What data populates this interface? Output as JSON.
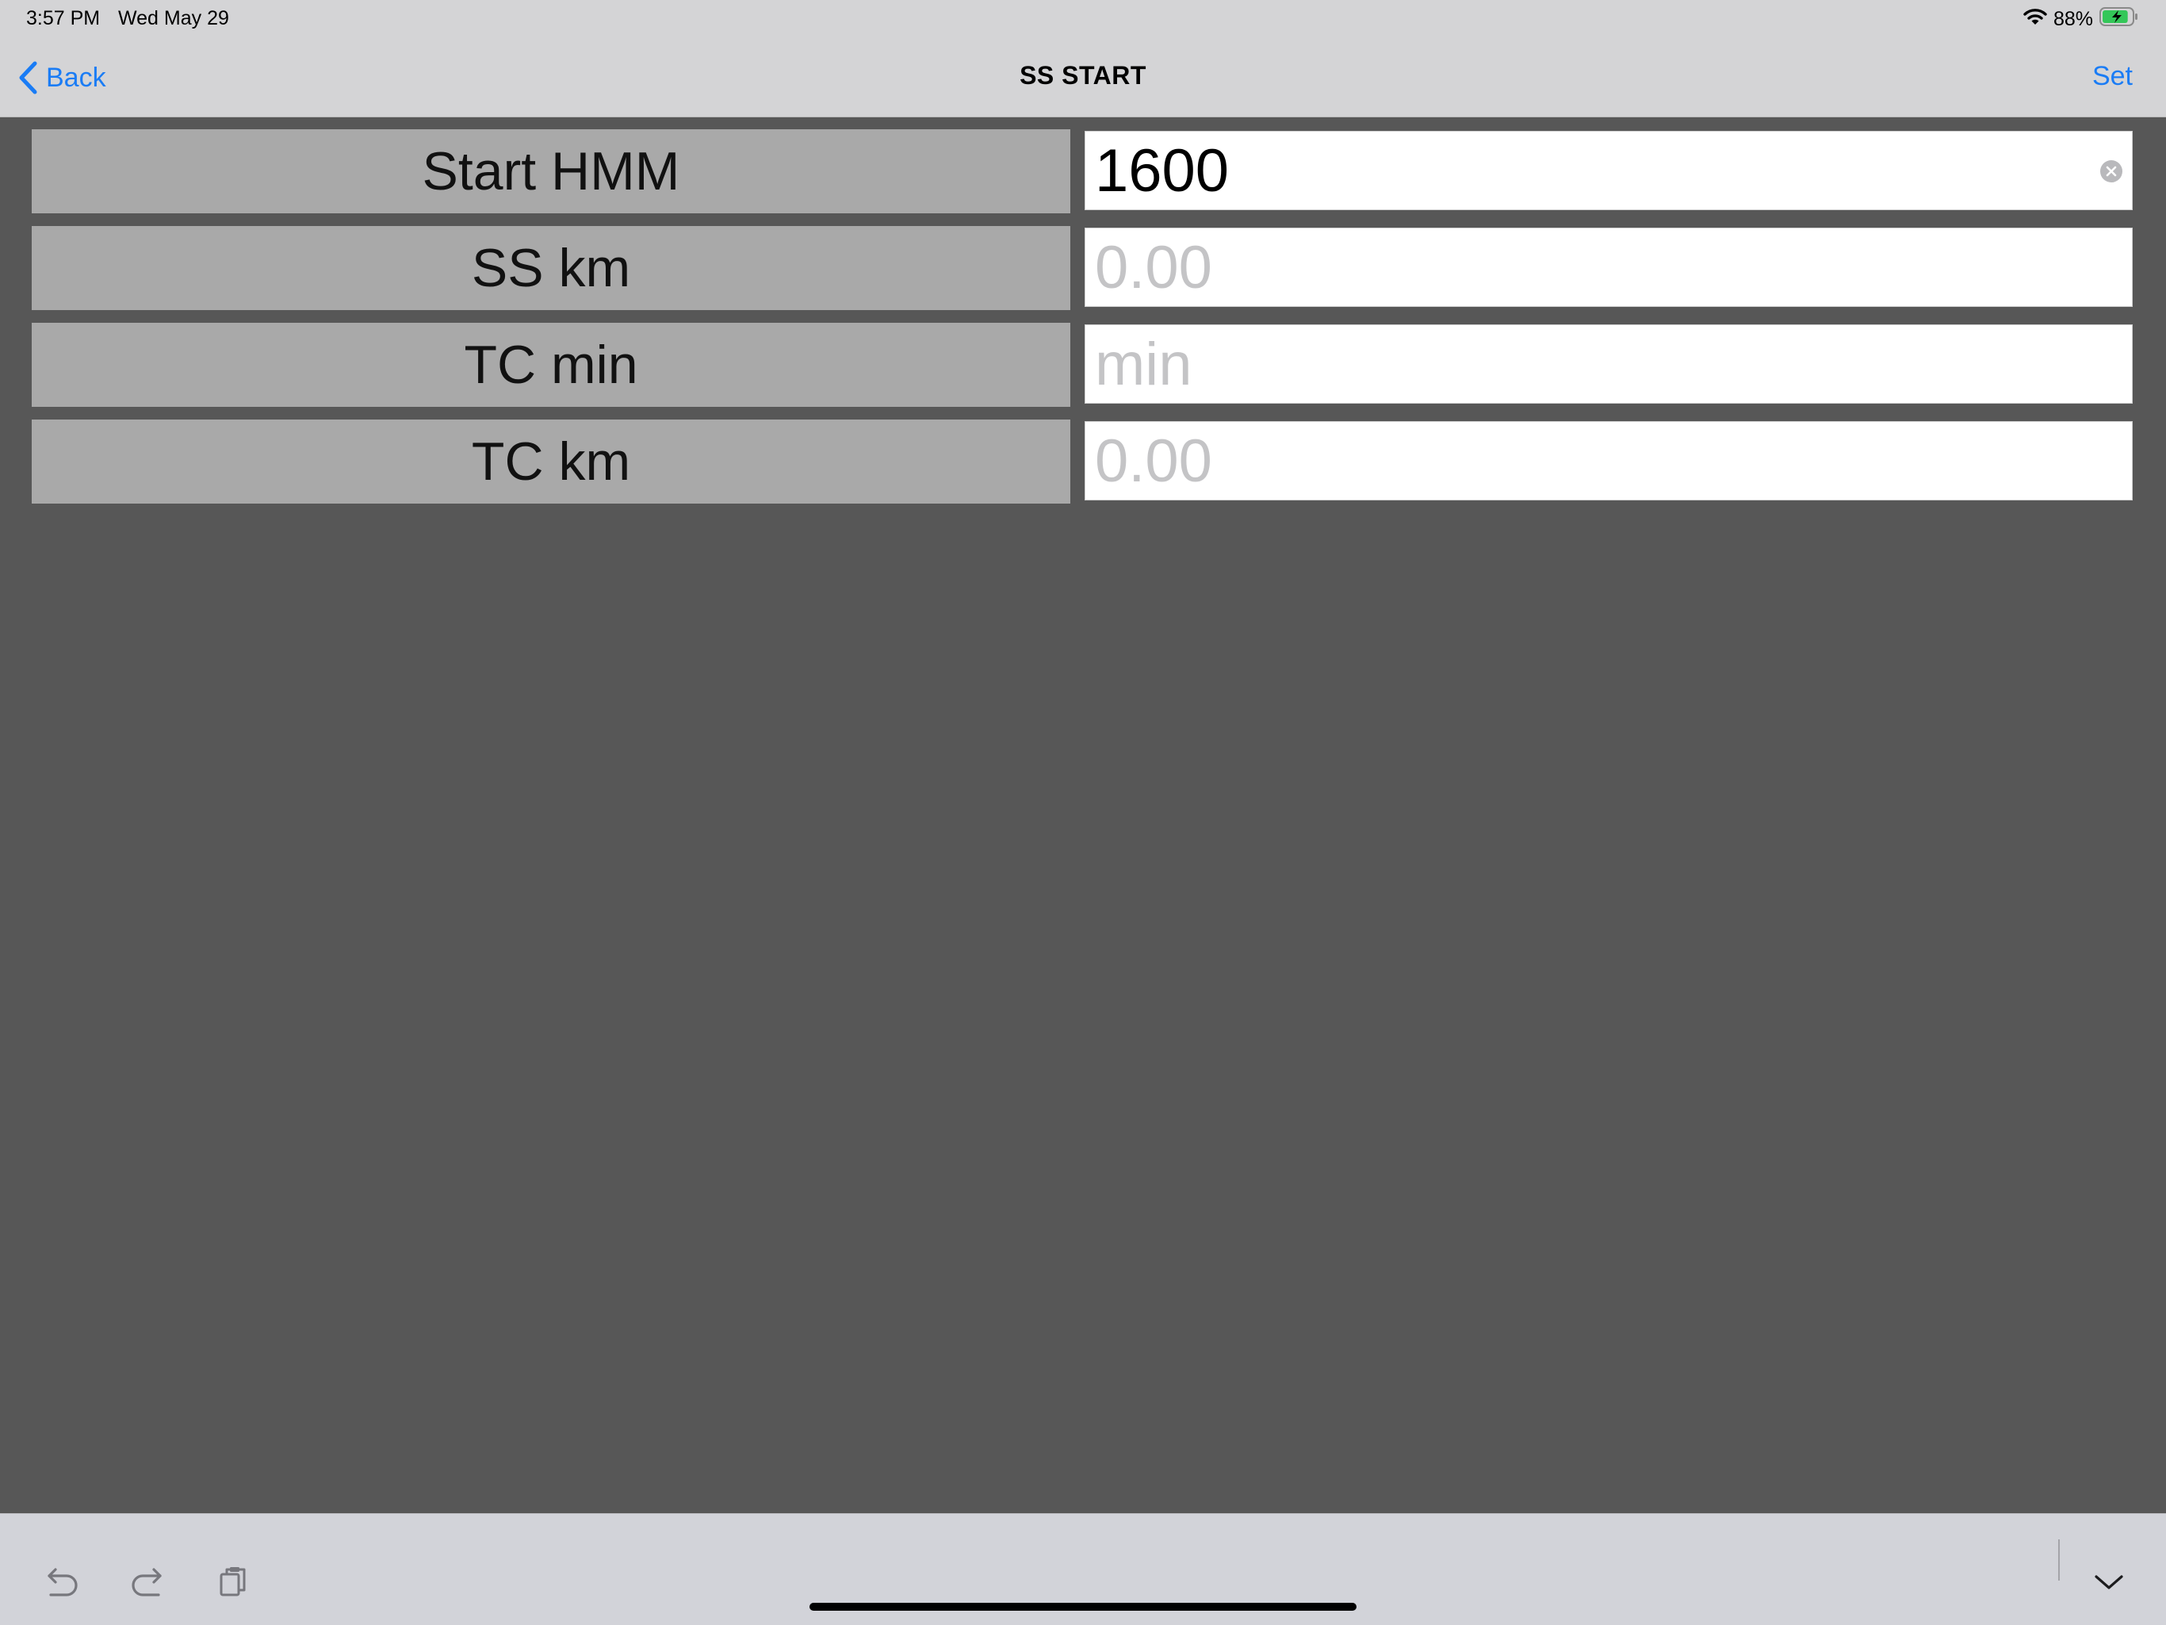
{
  "status_bar": {
    "time": "3:57 PM",
    "date": "Wed May 29",
    "battery_percent": "88%",
    "battery_level": 0.88,
    "battery_charging": true,
    "icons": [
      "wifi-icon",
      "battery-icon"
    ]
  },
  "nav": {
    "back_label": "Back",
    "title": "SS START",
    "action_label": "Set",
    "accent_color": "#1a7cf5"
  },
  "form": {
    "rows": [
      {
        "label": "Start HMM",
        "value": "1600",
        "placeholder": ""
      },
      {
        "label": "SS km",
        "value": "",
        "placeholder": "0.00"
      },
      {
        "label": "TC min",
        "value": "",
        "placeholder": "min"
      },
      {
        "label": "TC km",
        "value": "",
        "placeholder": "0.00"
      }
    ]
  },
  "toolbar": {
    "icons": [
      "undo-icon",
      "redo-icon",
      "paste-icon",
      "dismiss-keyboard-icon"
    ]
  }
}
